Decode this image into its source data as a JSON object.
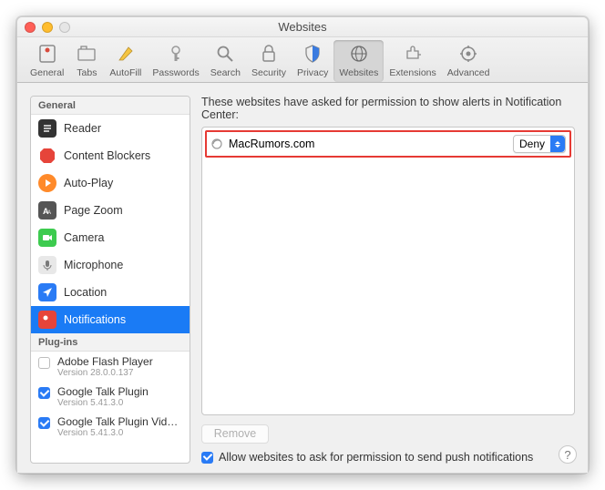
{
  "title": "Websites",
  "toolbar": [
    {
      "label": "General"
    },
    {
      "label": "Tabs"
    },
    {
      "label": "AutoFill"
    },
    {
      "label": "Passwords"
    },
    {
      "label": "Search"
    },
    {
      "label": "Security"
    },
    {
      "label": "Privacy"
    },
    {
      "label": "Websites"
    },
    {
      "label": "Extensions"
    },
    {
      "label": "Advanced"
    }
  ],
  "sidebar": {
    "general_header": "General",
    "items": [
      {
        "label": "Reader"
      },
      {
        "label": "Content Blockers"
      },
      {
        "label": "Auto-Play"
      },
      {
        "label": "Page Zoom"
      },
      {
        "label": "Camera"
      },
      {
        "label": "Microphone"
      },
      {
        "label": "Location"
      },
      {
        "label": "Notifications"
      }
    ],
    "plugins_header": "Plug-ins",
    "plugins": [
      {
        "name": "Adobe Flash Player",
        "version": "Version 28.0.0.137",
        "checked": false
      },
      {
        "name": "Google Talk Plugin",
        "version": "Version 5.41.3.0",
        "checked": true
      },
      {
        "name": "Google Talk Plugin Vid…",
        "version": "Version 5.41.3.0",
        "checked": true
      }
    ]
  },
  "main": {
    "description": "These websites have asked for permission to show alerts in Notification Center:",
    "rows": [
      {
        "name": "MacRumors.com",
        "value": "Deny"
      }
    ],
    "remove_label": "Remove",
    "allow_label": "Allow websites to ask for permission to send push notifications"
  },
  "help": "?"
}
